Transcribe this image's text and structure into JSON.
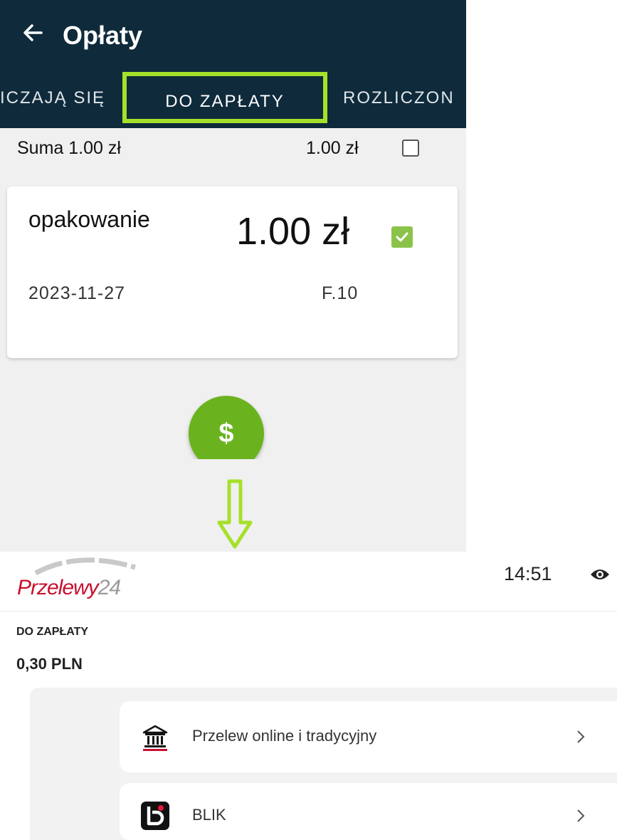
{
  "app": {
    "title": "Opłaty",
    "tabs": [
      {
        "label": "ICZAJĄ SIĘ"
      },
      {
        "label": "DO ZAPŁATY"
      },
      {
        "label": "ROZLICZON"
      }
    ],
    "summary": {
      "label": "Suma 1.00 zł",
      "value": "1.00 zł",
      "checked": false
    },
    "fee": {
      "name": "opakowanie",
      "amount": "1.00 zł",
      "date": "2023-11-27",
      "code": "F.10",
      "checked": true
    },
    "pay_button": {
      "icon": "dollar-icon",
      "glyph": "$"
    },
    "highlight_color": "#a6e02a",
    "appbar_color": "#0f2a3b"
  },
  "annotation": {
    "arrow_icon": "down-arrow-icon",
    "color": "#a6e02a"
  },
  "payment": {
    "brand": {
      "text": "Przelewy",
      "number": "24",
      "color": "#c8102e"
    },
    "clock": "14:51",
    "visibility_icon": "eye-icon",
    "due": {
      "label": "DO ZAPŁATY",
      "amount": "0,30 PLN"
    },
    "methods": [
      {
        "label": "Przelew online i tradycyjny",
        "icon": "bank-icon"
      },
      {
        "label": "BLIK",
        "icon": "blik-icon"
      }
    ]
  }
}
